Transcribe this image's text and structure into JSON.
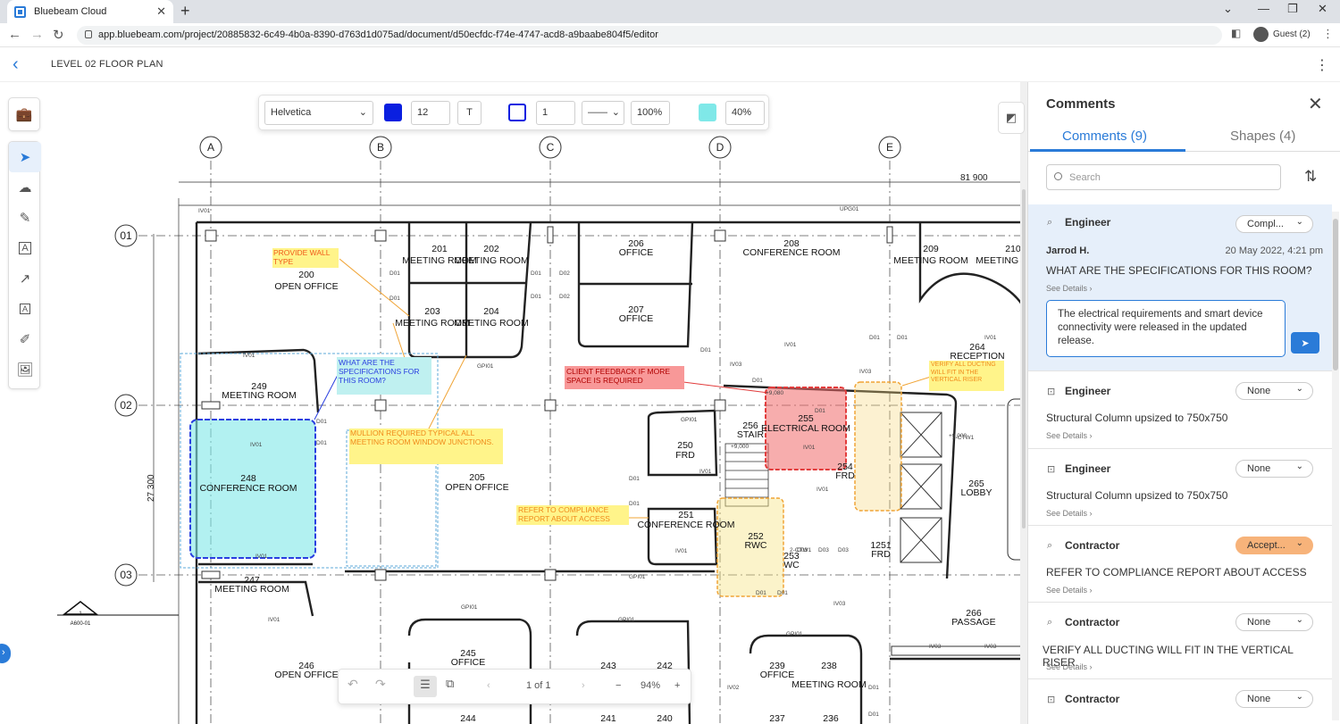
{
  "browser": {
    "tab_title": "Bluebeam Cloud",
    "url": "app.bluebeam.com/project/20885832-6c49-4b0a-8390-d763d1d075ad/document/d50ecfdc-f74e-4747-acd8-a9baabe804f5/editor",
    "profile": "Guest (2)"
  },
  "app": {
    "doc_title": "LEVEL 02 FLOOR PLAN"
  },
  "toolbar": {
    "font": "Helvetica",
    "font_size": "12",
    "text_tool": "T",
    "line_width": "1",
    "opacity": "100%",
    "fill_opacity": "40%",
    "text_color": "#0a1fe0",
    "fill_color": "#7fe8e8"
  },
  "pager": {
    "page_label": "1 of 1",
    "zoom": "94%"
  },
  "drawing": {
    "grid_cols": [
      "A",
      "B",
      "C",
      "D",
      "E"
    ],
    "grid_rows": [
      "01",
      "02",
      "03"
    ],
    "dimension": "81 900",
    "side_dimension": "27 300",
    "section_tag": "1",
    "section_ref": "A600-01",
    "rooms": [
      {
        "num": "200",
        "name": "OPEN OFFICE"
      },
      {
        "num": "201",
        "name": "MEETING ROOM"
      },
      {
        "num": "202",
        "name": "MEETING ROOM"
      },
      {
        "num": "203",
        "name": "MEETING ROOM"
      },
      {
        "num": "204",
        "name": "MEETING ROOM"
      },
      {
        "num": "206",
        "name": "OFFICE"
      },
      {
        "num": "207",
        "name": "OFFICE"
      },
      {
        "num": "208",
        "name": "CONFERENCE ROOM"
      },
      {
        "num": "209",
        "name": "MEETING ROOM"
      },
      {
        "num": "210",
        "name": "MEETING ROOM"
      },
      {
        "num": "249",
        "name": "MEETING ROOM"
      },
      {
        "num": "248",
        "name": "CONFERENCE ROOM"
      },
      {
        "num": "205",
        "name": "OPEN OFFICE"
      },
      {
        "num": "250",
        "name": "FRD"
      },
      {
        "num": "251",
        "name": "CONFERENCE ROOM"
      },
      {
        "num": "256",
        "name": "STAIR"
      },
      {
        "num": "255",
        "name": "ELECTRICAL ROOM"
      },
      {
        "num": "254",
        "name": "FRD"
      },
      {
        "num": "252",
        "name": "RWC"
      },
      {
        "num": "253",
        "name": "WC"
      },
      {
        "num": "1251",
        "name": "FRD"
      },
      {
        "num": "264",
        "name": "RECEPTION"
      },
      {
        "num": "265",
        "name": "LOBBY"
      },
      {
        "num": "266",
        "name": "PASSAGE"
      },
      {
        "num": "247",
        "name": "MEETING ROOM"
      },
      {
        "num": "246",
        "name": "OPEN OFFICE"
      },
      {
        "num": "245",
        "name": "OFFICE"
      },
      {
        "num": "243",
        "name": ""
      },
      {
        "num": "242",
        "name": ""
      },
      {
        "num": "239",
        "name": "OFFICE"
      },
      {
        "num": "238",
        "name": "MEETING ROOM"
      },
      {
        "num": "244",
        "name": ""
      },
      {
        "num": "241",
        "name": ""
      },
      {
        "num": "240",
        "name": ""
      },
      {
        "num": "237",
        "name": ""
      },
      {
        "num": "236",
        "name": ""
      }
    ],
    "markups": {
      "wall_type": "PROVIDE WALL TYPE",
      "specs": "WHAT ARE THE SPECIFICATIONS FOR THIS ROOM?",
      "mullion": "MULLION REQUIRED TYPICAL ALL MEETING ROOM WINDOW JUNCTIONS.",
      "client": "CLIENT FEEDBACK IF MORE SPACE IS REQUIRED",
      "ducting": "VERIFY ALL DUCTING WILL FIT IN THE VERTICAL RISER",
      "compliance": "REFER TO COMPLIANCE REPORT ABOUT ACCESS"
    },
    "tags": [
      "D01",
      "IV01",
      "GPI01",
      "UPG01",
      "IV03",
      "IV02",
      "D02",
      "D03",
      "+9,080",
      "+9,000",
      "2-CTW1"
    ]
  },
  "comments": {
    "title": "Comments",
    "tab_comments": "Comments (9)",
    "tab_shapes": "Shapes (4)",
    "search_placeholder": "Search",
    "see_details": "See Details",
    "items": [
      {
        "role": "Engineer",
        "status": "Compl...",
        "author": "Jarrod H.",
        "date": "20 May 2022, 4:21 pm",
        "text": "WHAT ARE THE SPECIFICATIONS FOR THIS ROOM?",
        "reply": "The electrical requirements and smart device connectivity were released in the updated release."
      },
      {
        "role": "Engineer",
        "status": "None",
        "text": "Structural Column upsized to 750x750"
      },
      {
        "role": "Engineer",
        "status": "None",
        "text": "Structural Column upsized to 750x750"
      },
      {
        "role": "Contractor",
        "status": "Accept...",
        "text": "REFER TO COMPLIANCE REPORT ABOUT ACCESS"
      },
      {
        "role": "Contractor",
        "status": "None",
        "text": "VERIFY ALL DUCTING WILL FIT IN THE VERTICAL RISER."
      },
      {
        "role": "Contractor",
        "status": "None",
        "text": ""
      }
    ]
  }
}
